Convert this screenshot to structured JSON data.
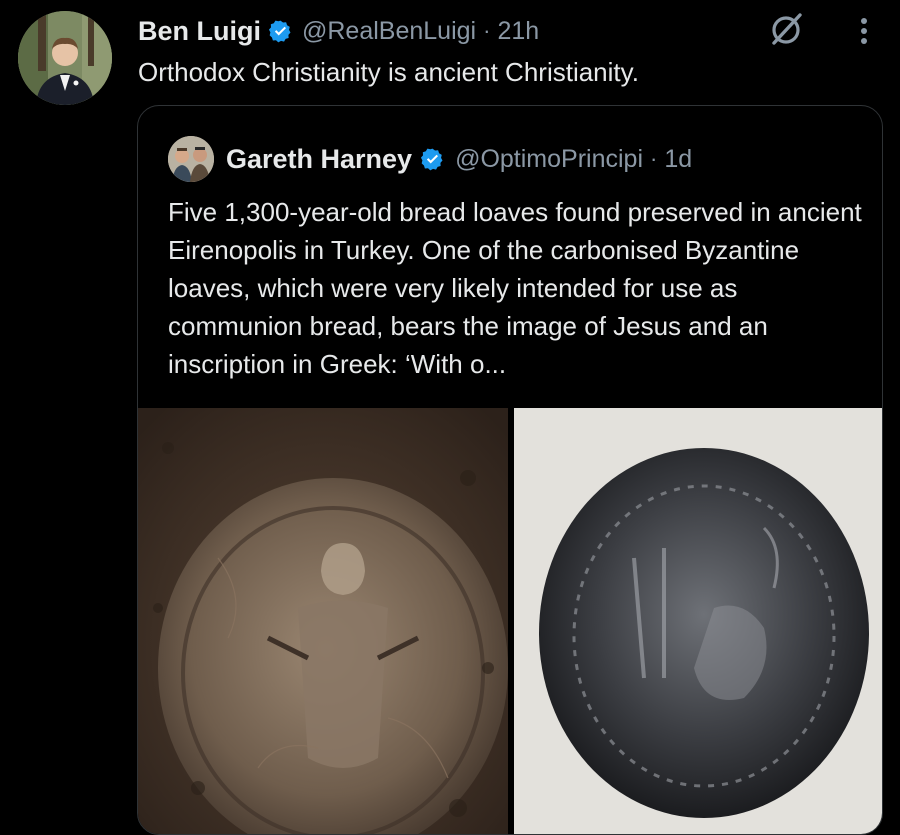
{
  "tweet": {
    "author_name": "Ben Luigi",
    "handle": "@RealBenLuigi",
    "separator": "·",
    "time": "21h",
    "text": "Orthodox Christianity is ancient Christianity."
  },
  "quoted_tweet": {
    "author_name": "Gareth Harney",
    "handle": "@OptimoPrincipi",
    "separator": "·",
    "time": "1d",
    "text": "Five 1,300-year-old bread loaves found preserved in ancient Eirenopolis in Turkey. One of the carbonised Byzantine loaves, which were very likely intended for use as communion bread, bears the image of Jesus and an inscription in Greek: ‘With o..."
  },
  "icons": {
    "verified": "verified-badge-icon",
    "grok": "grok-icon",
    "more": "more-options-icon"
  },
  "colors": {
    "background": "#000000",
    "text": "#e7e9ea",
    "secondary_text": "#8b98a5",
    "verified_blue": "#1d9bf0",
    "border": "#2f3336"
  }
}
